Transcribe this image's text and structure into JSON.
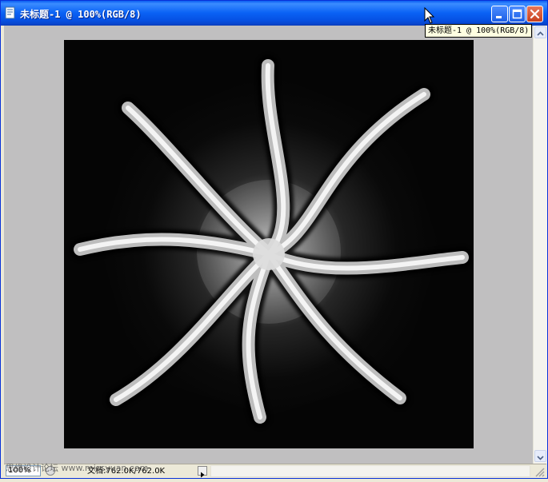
{
  "window": {
    "title": "未标题-1 @ 100%(RGB/8)",
    "tooltip": "未标题-1 @ 100%(RGB/8)",
    "controls": {
      "minimize": "minimize-icon",
      "maximize": "maximize-icon",
      "close": "close-icon"
    },
    "titlebar_color": "#0a5ef1"
  },
  "status": {
    "zoom": "100%",
    "doc_info": "文档:762.0K/762.0K"
  },
  "watermark": "思缘设计论坛 www.missyuan.com",
  "canvas": {
    "background": "#c0bfc0",
    "image_background": "#050505"
  }
}
